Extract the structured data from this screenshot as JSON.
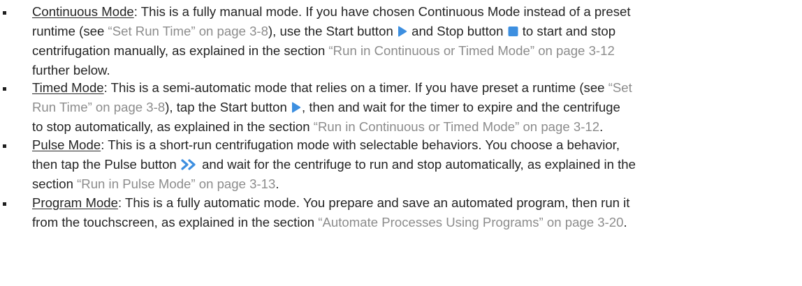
{
  "items": [
    {
      "term": "Continuous Mode",
      "lines": [
        [
          {
            "t": "term",
            "v": "Continuous Mode"
          },
          {
            "t": "text",
            "v": ": This is a fully manual mode. If you have chosen Continuous Mode instead of a preset"
          }
        ],
        [
          {
            "t": "text",
            "v": "runtime (see "
          },
          {
            "t": "xref",
            "v": "“Set Run Time” on page 3-8"
          },
          {
            "t": "text",
            "v": "), use the Start button "
          },
          {
            "t": "icon",
            "icon": "play-icon"
          },
          {
            "t": "text",
            "v": " and Stop button "
          },
          {
            "t": "icon",
            "icon": "stop-icon"
          },
          {
            "t": "text",
            "v": " to start and stop"
          }
        ],
        [
          {
            "t": "text",
            "v": "centrifugation manually, as explained in the section "
          },
          {
            "t": "xref",
            "v": "“Run in Continuous or Timed Mode” on page 3-12"
          }
        ],
        [
          {
            "t": "text",
            "v": "further below."
          }
        ]
      ]
    },
    {
      "term": "Timed Mode",
      "lines": [
        [
          {
            "t": "term",
            "v": "Timed Mode"
          },
          {
            "t": "text",
            "v": ": This is a semi-automatic mode that relies on a timer. If you have preset a runtime (see "
          },
          {
            "t": "xref",
            "v": "“Set"
          }
        ],
        [
          {
            "t": "xref",
            "v": "Run Time” on page 3-8"
          },
          {
            "t": "text",
            "v": "), tap the Start button "
          },
          {
            "t": "icon",
            "icon": "play-icon"
          },
          {
            "t": "text",
            "v": ", then and wait for the timer to expire and the centrifuge"
          }
        ],
        [
          {
            "t": "text",
            "v": "to stop automatically, as explained in the section "
          },
          {
            "t": "xref",
            "v": "“Run in Continuous or Timed Mode” on page 3-12"
          },
          {
            "t": "text",
            "v": "."
          }
        ]
      ]
    },
    {
      "term": "Pulse Mode",
      "lines": [
        [
          {
            "t": "term",
            "v": "Pulse Mode"
          },
          {
            "t": "text",
            "v": ": This is a short-run centrifugation mode with selectable behaviors. You choose a behavior,"
          }
        ],
        [
          {
            "t": "text",
            "v": "then tap the Pulse button "
          },
          {
            "t": "icon",
            "icon": "pulse-icon"
          },
          {
            "t": "text",
            "v": " and wait for the centrifuge to run and stop automatically, as explained in the"
          }
        ],
        [
          {
            "t": "text",
            "v": "section "
          },
          {
            "t": "xref",
            "v": "“Run in Pulse Mode” on page 3-13"
          },
          {
            "t": "text",
            "v": "."
          }
        ]
      ]
    },
    {
      "term": "Program Mode",
      "lines": [
        [
          {
            "t": "term",
            "v": "Program Mode"
          },
          {
            "t": "text",
            "v": ": This is a fully automatic mode. You prepare and save an automated program, then run it"
          }
        ],
        [
          {
            "t": "text",
            "v": "from the touchscreen, as explained in the section "
          },
          {
            "t": "xref",
            "v": "“Automate Processes Using Programs” on page 3-20"
          },
          {
            "t": "text",
            "v": "."
          }
        ]
      ]
    }
  ],
  "colors": {
    "text": "#242424",
    "xref": "#8c8c8c",
    "icon": "#3d8fe0"
  }
}
